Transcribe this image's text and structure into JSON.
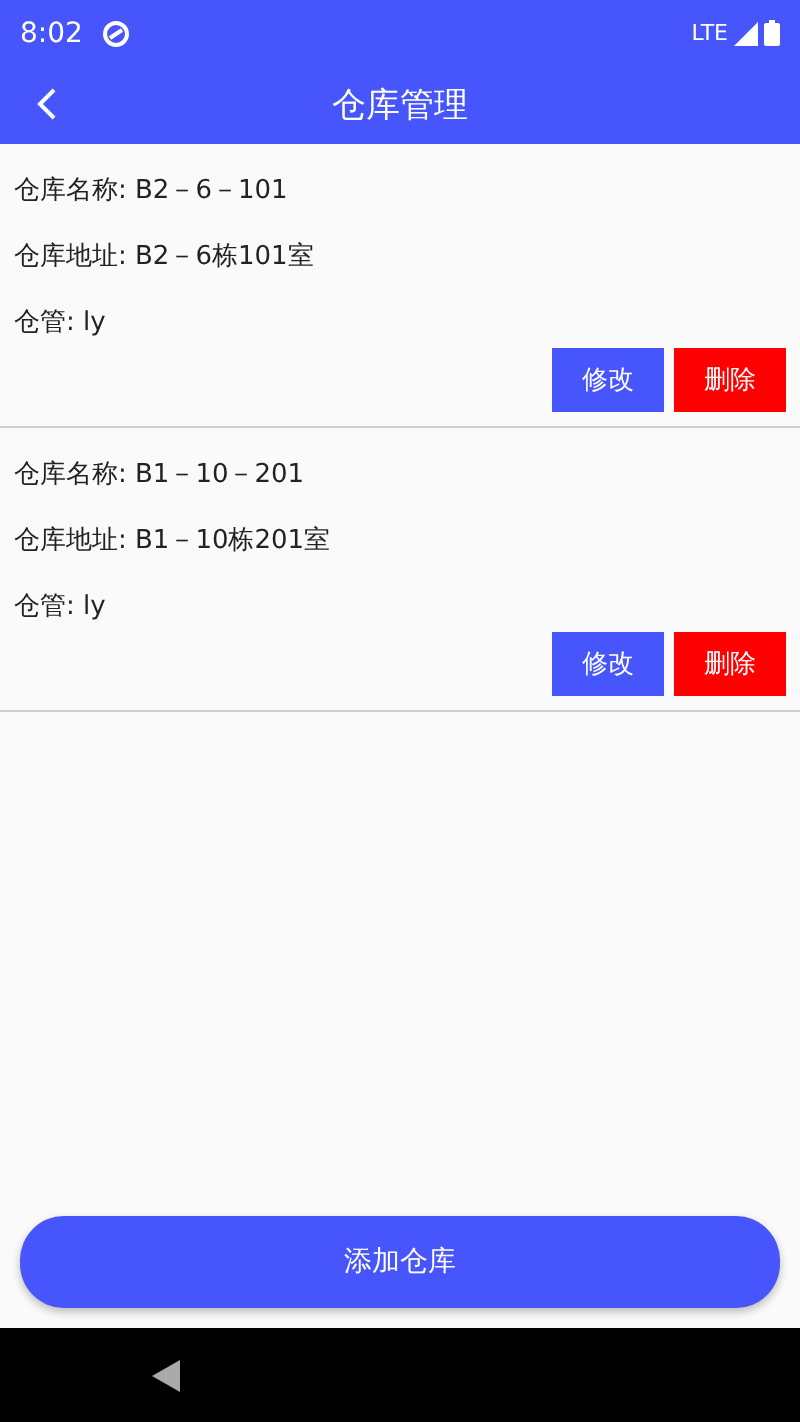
{
  "status_bar": {
    "time": "8:02",
    "network": "LTE"
  },
  "app_bar": {
    "title": "仓库管理"
  },
  "warehouses": [
    {
      "name": "仓库名称: B2－6－101",
      "address": "仓库地址: B2－6栋101室",
      "keeper": "仓管: ly",
      "buttons": [
        "修改",
        "删除"
      ]
    },
    {
      "name": "仓库名称: B1－10－201",
      "address": "仓库地址: B1－10栋201室",
      "keeper": "仓管: ly",
      "buttons": [
        "修改",
        "删除"
      ]
    }
  ],
  "add_button": "添加仓库"
}
